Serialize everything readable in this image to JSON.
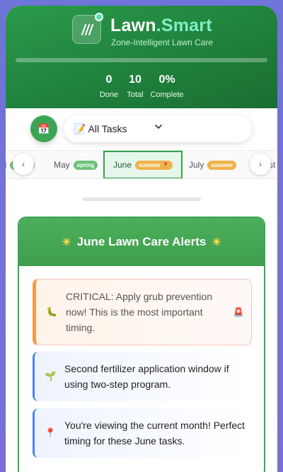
{
  "app": {
    "brand_main": "Lawn",
    "brand_dot": ".",
    "brand_accent": "Smart",
    "tagline": "Zone-Intelligent Lawn Care",
    "progress": 0
  },
  "stats": [
    {
      "value": "0",
      "label": "Done"
    },
    {
      "value": "10",
      "label": "Total"
    },
    {
      "value": "0%",
      "label": "Complete"
    }
  ],
  "filter": {
    "calendar_icon": "calendar-icon",
    "select_label": "📝 All Tasks"
  },
  "months": [
    {
      "name": "il",
      "season": "spring",
      "season_color": "#6cc27a",
      "state": "partial"
    },
    {
      "name": "May",
      "season": "spring",
      "season_color": "#6cc27a"
    },
    {
      "name": "June",
      "season": "summer 📍",
      "season_color": "#f0b24a",
      "active": true
    },
    {
      "name": "July",
      "season": "summer",
      "season_color": "#f0b24a"
    },
    {
      "name": "st",
      "season": "",
      "state": "partial"
    }
  ],
  "nav": {
    "prev": "‹",
    "next": "›"
  },
  "alerts": {
    "title": "June Lawn Care Alerts",
    "star": "☀",
    "items": [
      {
        "icon": "🐛",
        "text": "CRITICAL: Apply grub prevention now! This is the most important timing.",
        "type": "critical",
        "badge": "🚨"
      },
      {
        "icon": "🌱",
        "text": "Second fertilizer application window if using two-step program.",
        "type": "info"
      },
      {
        "icon": "📍",
        "text": "You're viewing the current month! Perfect timing for these June tasks.",
        "type": "info"
      }
    ]
  },
  "colors": {
    "header_green": "#1f7f3b",
    "accent_mint": "#7ff0c4",
    "summer_badge": "#f0b24a",
    "spring_badge": "#6cc27a"
  }
}
